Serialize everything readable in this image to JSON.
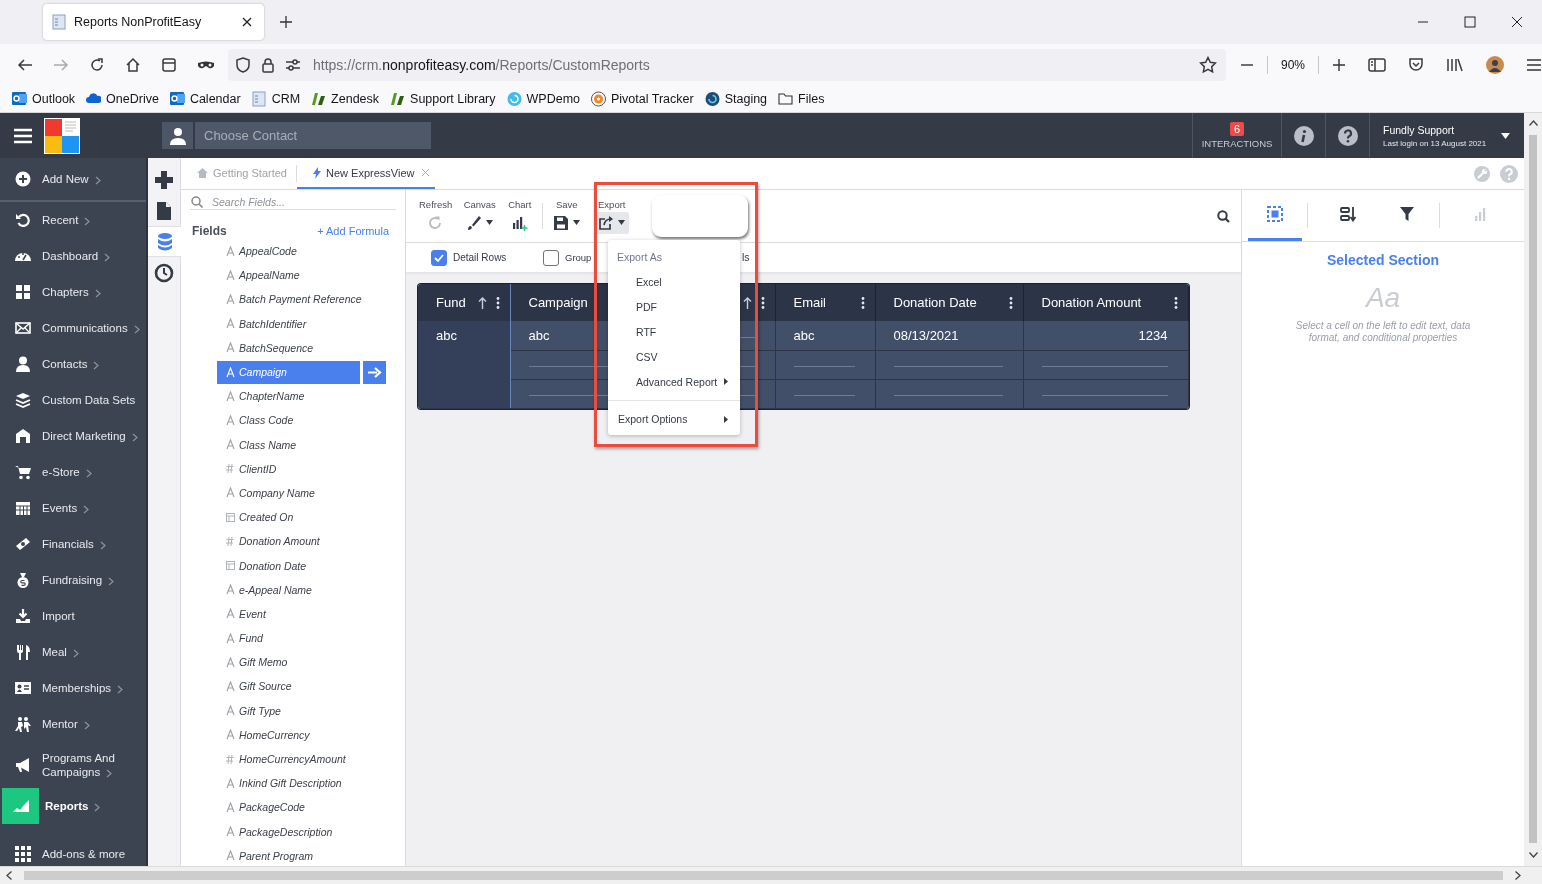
{
  "browser": {
    "tab_title": "Reports NonProfitEasy",
    "url": {
      "prefix": "https://crm.",
      "domain": "nonprofiteasy.com",
      "path": "/Reports/CustomReports"
    },
    "zoom": "90%",
    "bookmarks": [
      "Outlook",
      "OneDrive",
      "Calendar",
      "CRM",
      "Zendesk",
      "Support Library",
      "WPDemo",
      "Pivotal Tracker",
      "Staging",
      "Files"
    ]
  },
  "header": {
    "contact_placeholder": "Choose Contact",
    "interactions_count": "6",
    "interactions_label": "INTERACTIONS",
    "user_name": "Fundly Support",
    "last_login": "Last login on 13 August 2021"
  },
  "sidebar": {
    "items": [
      {
        "label": "Add New",
        "submenu": true,
        "selected": false
      },
      {
        "label": "Recent",
        "submenu": true,
        "selected": false
      },
      {
        "label": "Dashboard",
        "submenu": true,
        "selected": false
      },
      {
        "label": "Chapters",
        "submenu": true,
        "selected": false
      },
      {
        "label": "Communications",
        "submenu": true,
        "selected": false
      },
      {
        "label": "Contacts",
        "submenu": true,
        "selected": false
      },
      {
        "label": "Custom Data Sets",
        "submenu": false,
        "selected": false
      },
      {
        "label": "Direct Marketing",
        "submenu": true,
        "selected": false
      },
      {
        "label": "e-Store",
        "submenu": true,
        "selected": false
      },
      {
        "label": "Events",
        "submenu": true,
        "selected": false
      },
      {
        "label": "Financials",
        "submenu": true,
        "selected": false
      },
      {
        "label": "Fundraising",
        "submenu": true,
        "selected": false
      },
      {
        "label": "Import",
        "submenu": false,
        "selected": false
      },
      {
        "label": "Meal",
        "submenu": true,
        "selected": false
      },
      {
        "label": "Memberships",
        "submenu": true,
        "selected": false
      },
      {
        "label": "Mentor",
        "submenu": true,
        "selected": false
      },
      {
        "label": "Programs And Campaigns",
        "submenu": true,
        "selected": false
      },
      {
        "label": "Reports",
        "submenu": true,
        "selected": true
      },
      {
        "label": "Add-ons & more",
        "submenu": false,
        "selected": false
      }
    ]
  },
  "rail": [
    {
      "selected": false
    },
    {
      "selected": false
    },
    {
      "selected": true
    },
    {
      "selected": false
    }
  ],
  "tabs": [
    {
      "label": "Getting Started",
      "selected": false,
      "closable": false
    },
    {
      "label": "New ExpressView",
      "selected": true,
      "closable": true
    }
  ],
  "fields_panel": {
    "search_placeholder": "Search Fields...",
    "title": "Fields",
    "add_formula": "+ Add Formula",
    "fields": [
      {
        "name": "AppealCode",
        "kind": "text",
        "selected": false
      },
      {
        "name": "AppealName",
        "kind": "text",
        "selected": false
      },
      {
        "name": "Batch Payment Reference",
        "kind": "text",
        "selected": false
      },
      {
        "name": "BatchIdentifier",
        "kind": "text",
        "selected": false
      },
      {
        "name": "BatchSequence",
        "kind": "text",
        "selected": false
      },
      {
        "name": "Campaign",
        "kind": "text",
        "selected": true
      },
      {
        "name": "ChapterName",
        "kind": "text",
        "selected": false
      },
      {
        "name": "Class Code",
        "kind": "text",
        "selected": false
      },
      {
        "name": "Class Name",
        "kind": "text",
        "selected": false
      },
      {
        "name": "ClientID",
        "kind": "number",
        "selected": false
      },
      {
        "name": "Company Name",
        "kind": "text",
        "selected": false
      },
      {
        "name": "Created On",
        "kind": "date",
        "selected": false
      },
      {
        "name": "Donation Amount",
        "kind": "number",
        "selected": false
      },
      {
        "name": "Donation Date",
        "kind": "date",
        "selected": false
      },
      {
        "name": "e-Appeal Name",
        "kind": "text",
        "selected": false
      },
      {
        "name": "Event",
        "kind": "text",
        "selected": false
      },
      {
        "name": "Fund",
        "kind": "text",
        "selected": false
      },
      {
        "name": "Gift Memo",
        "kind": "text",
        "selected": false
      },
      {
        "name": "Gift Source",
        "kind": "text",
        "selected": false
      },
      {
        "name": "Gift Type",
        "kind": "text",
        "selected": false
      },
      {
        "name": "HomeCurrency",
        "kind": "text",
        "selected": false
      },
      {
        "name": "HomeCurrencyAmount",
        "kind": "number",
        "selected": false
      },
      {
        "name": "Inkind Gift Description",
        "kind": "text",
        "selected": false
      },
      {
        "name": "PackageCode",
        "kind": "text",
        "selected": false
      },
      {
        "name": "PackageDescription",
        "kind": "text",
        "selected": false
      },
      {
        "name": "Parent Program",
        "kind": "text",
        "selected": false
      }
    ]
  },
  "toolbar": [
    {
      "label": "Refresh",
      "caret": false,
      "pressed": false
    },
    {
      "label": "Canvas",
      "caret": true,
      "pressed": false
    },
    {
      "label": "Chart",
      "caret": false,
      "pressed": false
    },
    {
      "label": "Save",
      "caret": true,
      "pressed": false
    },
    {
      "label": "Export",
      "caret": true,
      "pressed": true
    }
  ],
  "options": [
    {
      "label": "Detail Rows",
      "checked": true
    },
    {
      "label": "Group",
      "checked": false
    }
  ],
  "options_tail": "ls",
  "table": {
    "columns": [
      {
        "label": "Fund",
        "sorted": true
      },
      {
        "label": "Campaign",
        "sorted": false
      },
      {
        "sorted": true
      },
      {
        "label": "Email",
        "sorted": false
      },
      {
        "label": "Donation Date",
        "sorted": false
      },
      {
        "label": "Donation Amount",
        "sorted": false
      }
    ],
    "rows": [
      {
        "cells": [
          "abc",
          "abc",
          null,
          "abc",
          "08/13/2021",
          "1234"
        ]
      },
      {
        "cells": [
          null,
          null,
          null,
          null,
          null,
          null
        ]
      },
      {
        "cells": [
          null,
          null,
          null,
          null,
          null,
          null
        ]
      }
    ]
  },
  "export_menu": {
    "heading": "Export As",
    "items": [
      {
        "label": "Excel",
        "submenu": false
      },
      {
        "label": "PDF",
        "submenu": false
      },
      {
        "label": "RTF",
        "submenu": false
      },
      {
        "label": "CSV",
        "submenu": false
      },
      {
        "label": "Advanced Report",
        "submenu": true
      }
    ],
    "footer": {
      "label": "Export Options",
      "submenu": true
    }
  },
  "right_panel": {
    "tabs": [
      {
        "selected": true
      },
      {
        "selected": false
      },
      {
        "selected": false
      },
      {
        "selected": false
      }
    ],
    "title": "Selected Section",
    "sample": "Aa",
    "hint": "Select a cell on the left to edit text, data format, and conditional properties"
  }
}
